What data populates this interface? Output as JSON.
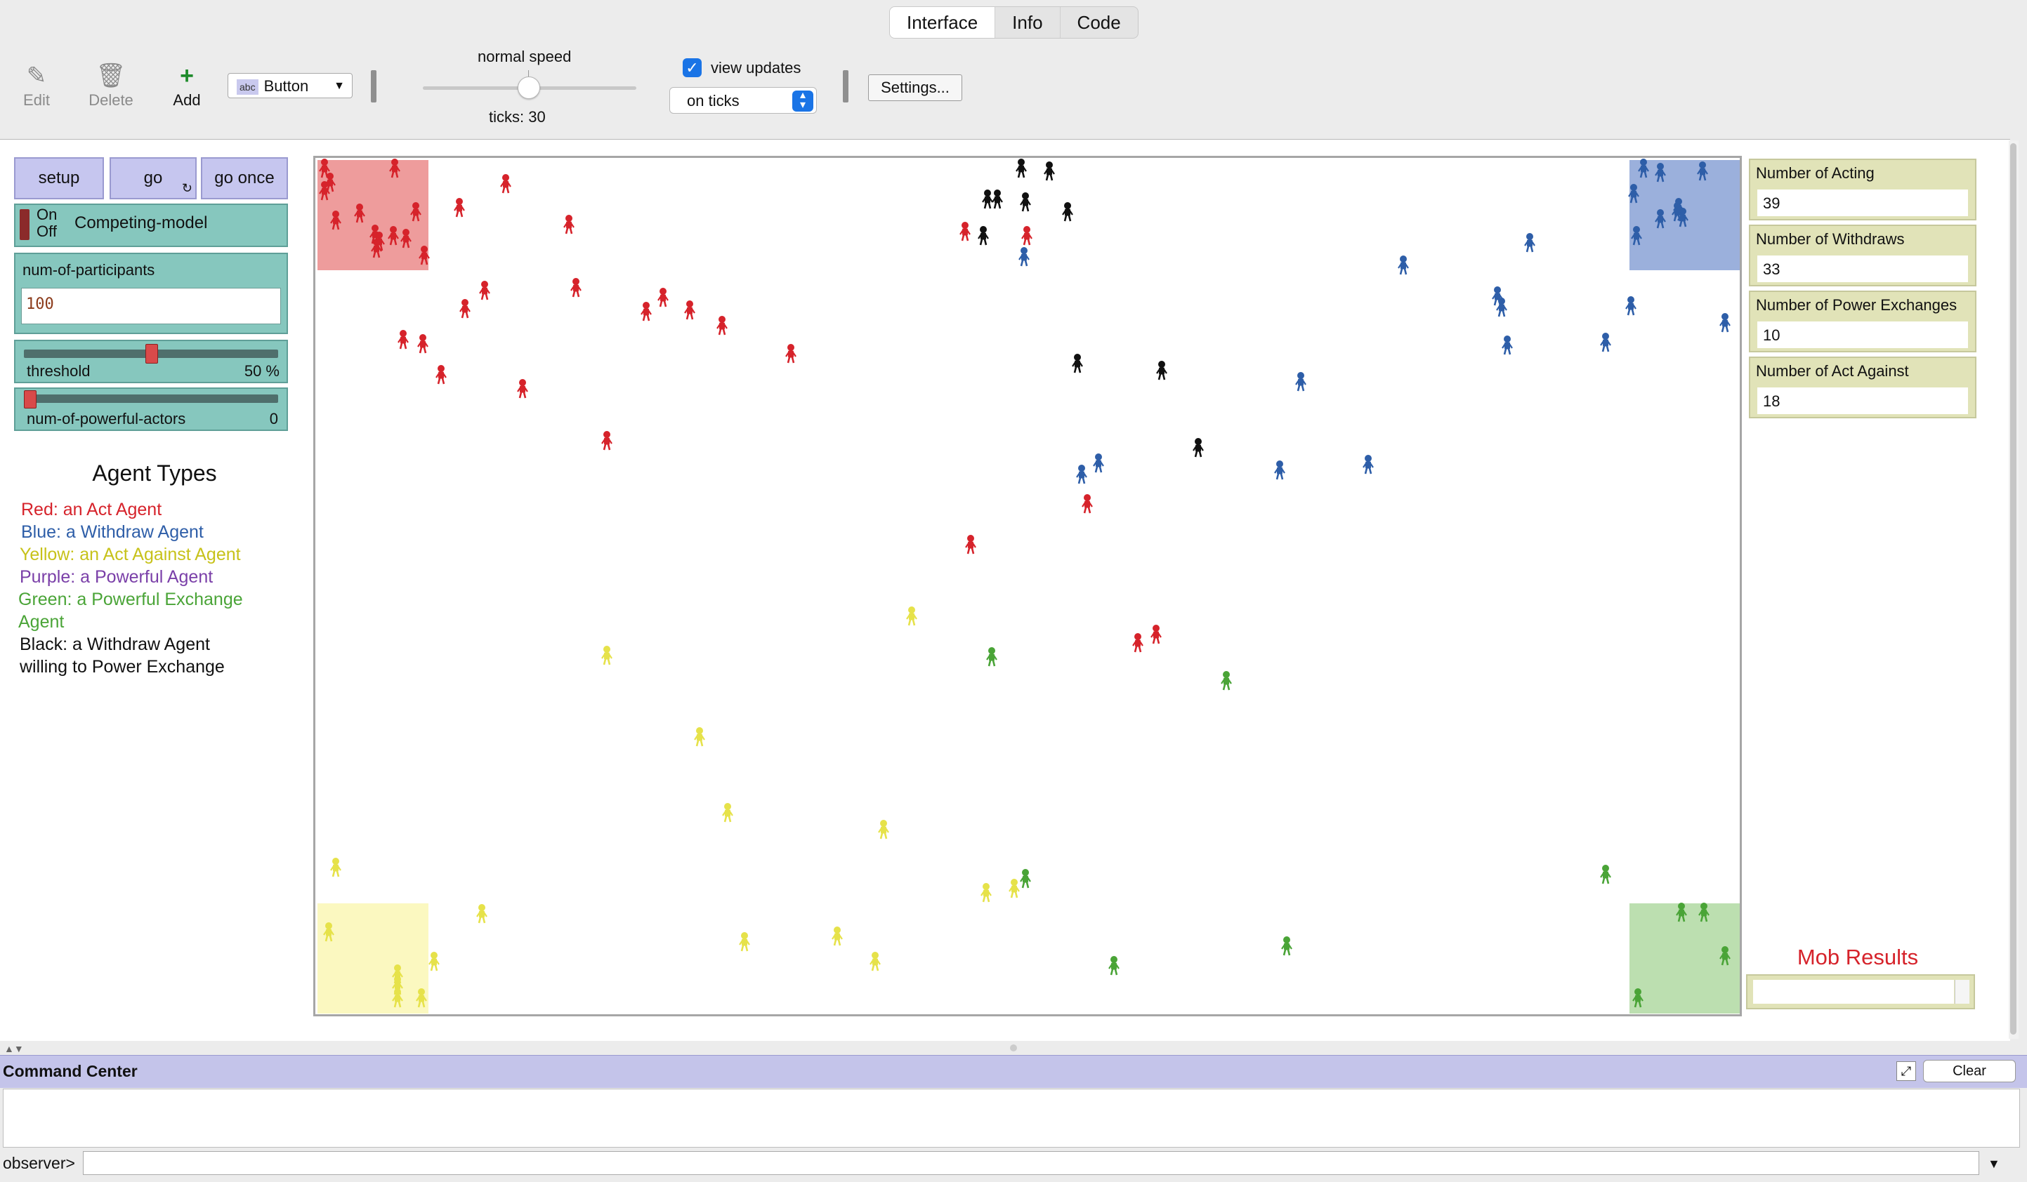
{
  "tabs": [
    {
      "label": "Interface",
      "active": true
    },
    {
      "label": "Info",
      "active": false
    },
    {
      "label": "Code",
      "active": false
    }
  ],
  "toolbar": {
    "edit_label": "Edit",
    "delete_label": "Delete",
    "add_label": "Add",
    "widget_type": "Button",
    "widget_type_icon_text": "abc",
    "speed_label": "normal speed",
    "ticks_label": "ticks: 30",
    "speed_level": 0.5,
    "view_updates_label": "view updates",
    "view_updates_checked": true,
    "update_mode": "on ticks",
    "settings_label": "Settings..."
  },
  "controls": {
    "setup_label": "setup",
    "go_label": "go",
    "go_once_label": "go once",
    "switch_on": "On",
    "switch_off": "Off",
    "switch_label": "Competing-model",
    "participants_label": "num-of-participants",
    "participants_value": "100",
    "threshold_label": "threshold",
    "threshold_value": "50 %",
    "threshold_level": 0.5,
    "powerful_label": "num-of-powerful-actors",
    "powerful_value": "0",
    "powerful_level": 0.0
  },
  "legend": {
    "title": "Agent Types",
    "red": "Red: an Act Agent",
    "blue": "Blue: a Withdraw Agent",
    "yellow": "Yellow: an Act Against Agent",
    "purple": "Purple: a Powerful Agent",
    "green_1": "Green: a Powerful Exchange",
    "green_2": "Agent",
    "black_1": "Black: a Withdraw Agent",
    "black_2": "willing to Power Exchange"
  },
  "monitors": [
    {
      "label": "Number of Acting",
      "value": "39"
    },
    {
      "label": "Number of Withdraws",
      "value": "33"
    },
    {
      "label": "Number of Power Exchanges",
      "value": "10"
    },
    {
      "label": "Number of Act Against",
      "value": "18"
    }
  ],
  "mob_results_label": "Mob Results",
  "mob_results_value": "",
  "colors": {
    "red": "#d6232b",
    "blue": "#2e5ea8",
    "yellow": "#e6e24a",
    "green": "#4aa437",
    "black": "#111111",
    "purple": "#7a3fa8",
    "red_patch": "#ee9c9c",
    "blue_patch": "#9bb0dc",
    "yellow_patch": "#fbf8c0",
    "green_patch": "#bcdfb0"
  },
  "command_center": {
    "title": "Command Center",
    "clear_label": "Clear",
    "prompt": "observer>"
  }
}
